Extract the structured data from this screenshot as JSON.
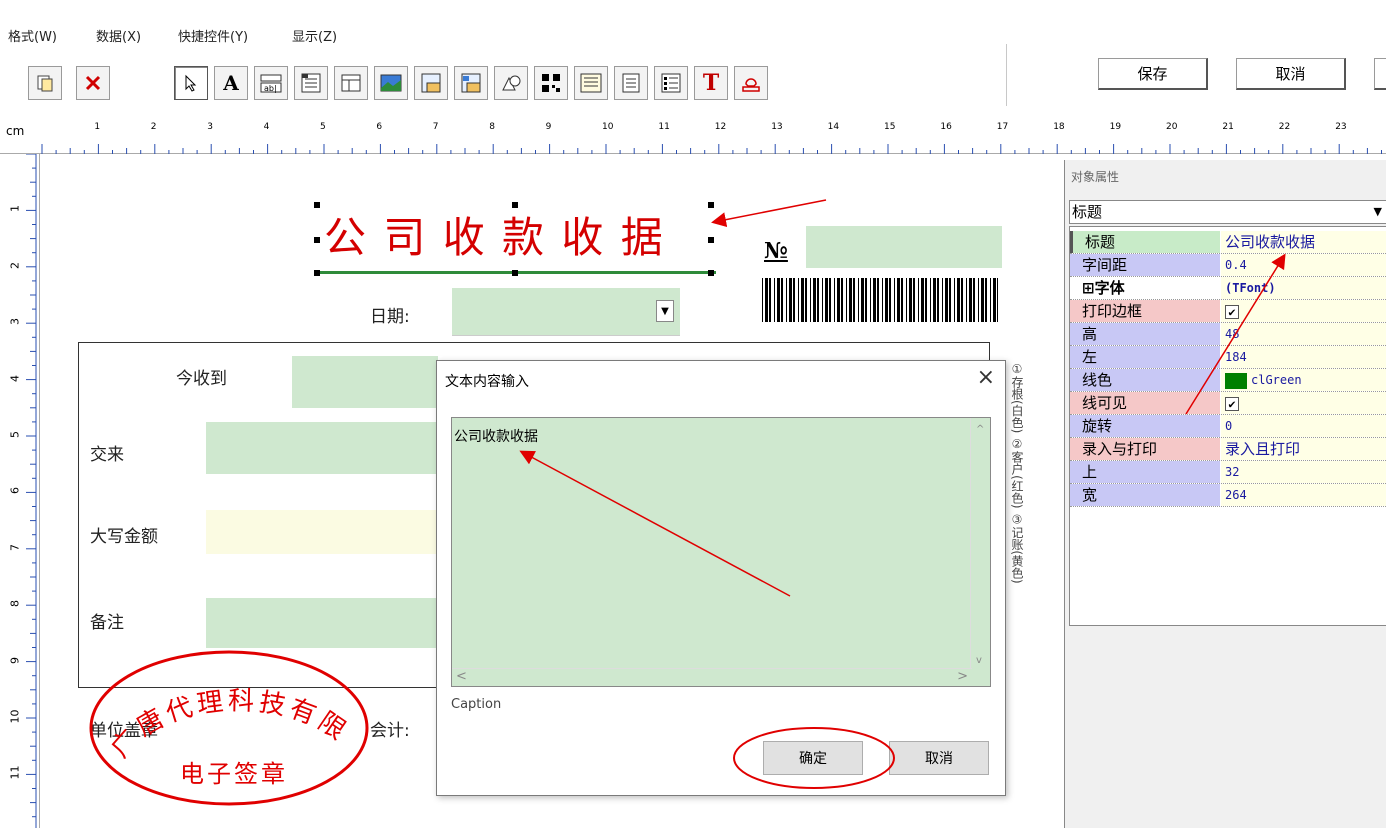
{
  "menu": [
    "格式(W)",
    "数据(X)",
    "快捷控件(Y)",
    "显示(Z)"
  ],
  "toolbar": {
    "icons": [
      "new-page-icon",
      "delete-icon",
      "pointer-icon",
      "text-icon",
      "edit-field-icon",
      "memo-icon",
      "table-icon",
      "image-icon",
      "grid-icon",
      "grid-edit-icon",
      "shapes-icon",
      "qrcode-icon",
      "barcode-icon",
      "document-icon",
      "list-icon",
      "font-t-icon",
      "stamp-icon"
    ],
    "save": "保存",
    "cancel": "取消"
  },
  "ruler": {
    "unit": "cm",
    "h_marks": [
      "1",
      "2",
      "3",
      "4",
      "5",
      "6",
      "7",
      "8",
      "9",
      "10",
      "11",
      "12",
      "13",
      "14",
      "15",
      "16",
      "17",
      "18",
      "19",
      "20",
      "21",
      "22",
      "23"
    ],
    "v_marks": [
      "1",
      "2",
      "3",
      "4",
      "5",
      "6",
      "7",
      "8",
      "9",
      "10",
      "11"
    ]
  },
  "canvas": {
    "title": "公 司 收 款 收 据",
    "no_label": "№",
    "date_label": "日期:",
    "received_label": "今收到",
    "from_label": "交来",
    "amount_label": "大写金额",
    "remark_label": "备注",
    "stamp_label": "单位盖章",
    "accountant_label": "会计:",
    "side_note": "①存根(白色) ②客户(红色) ③记账(黄色)",
    "seal_text": "广唐代理科技有限公司",
    "seal_caption": "电子签章"
  },
  "dialog": {
    "title": "文本内容输入",
    "text_value": "公司收款收据",
    "field_label": "Caption",
    "ok": "确定",
    "cancel": "取消"
  },
  "props": {
    "header": "对象属性",
    "selected_object": "标题",
    "rows": [
      {
        "key": "标题",
        "value": "公司收款收据"
      },
      {
        "key": "字间距",
        "value": "0.4"
      },
      {
        "key": "⊞字体",
        "value": "(TFont)"
      },
      {
        "key": "打印边框",
        "value": "✔"
      },
      {
        "key": "高",
        "value": "48"
      },
      {
        "key": "左",
        "value": "184"
      },
      {
        "key": "线色",
        "value": "clGreen"
      },
      {
        "key": "线可见",
        "value": "✔"
      },
      {
        "key": "旋转",
        "value": "0"
      },
      {
        "key": "录入与打印",
        "value": "录入且打印"
      },
      {
        "key": "上",
        "value": "32"
      },
      {
        "key": "宽",
        "value": "264"
      }
    ]
  },
  "colors": {
    "title_red": "#d40000",
    "field_green": "#cfe8cf",
    "field_yellow": "#fbfbe2",
    "annotation_red": "#e00000",
    "line_color_swatch": "#008000"
  }
}
